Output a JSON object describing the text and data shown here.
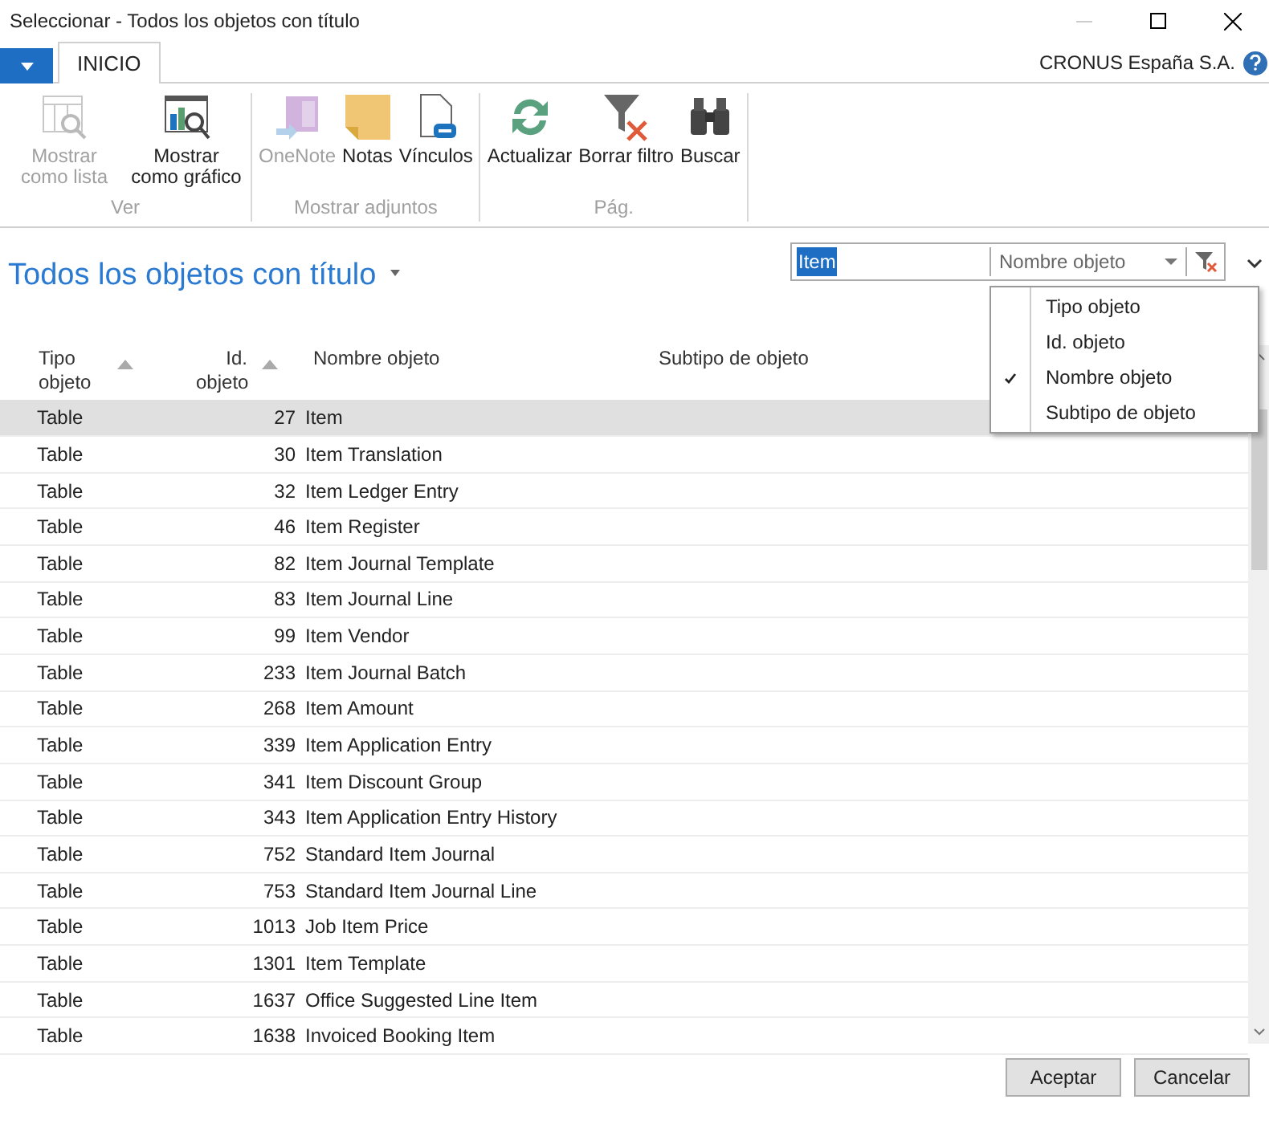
{
  "window": {
    "title": "Seleccionar - Todos los objetos con título"
  },
  "tabs": [
    {
      "label": "INICIO",
      "selected": true
    }
  ],
  "company": "CRONUS España S.A.",
  "ribbon_groups": [
    {
      "label": "Ver",
      "buttons": [
        {
          "label": "Mostrar como lista",
          "disabled": true
        },
        {
          "label": "Mostrar como gráfico",
          "disabled": false
        }
      ]
    },
    {
      "label": "Mostrar adjuntos",
      "buttons": [
        {
          "label": "OneNote",
          "disabled": true
        },
        {
          "label": "Notas",
          "disabled": false
        },
        {
          "label": "Vínculos",
          "disabled": false
        }
      ]
    },
    {
      "label": "Pág.",
      "buttons": [
        {
          "label": "Actualizar",
          "disabled": false
        },
        {
          "label": "Borrar filtro",
          "disabled": false
        },
        {
          "label": "Buscar",
          "disabled": false
        }
      ]
    }
  ],
  "page_title": "Todos los objetos con título",
  "filter": {
    "value": "Item",
    "field": "Nombre objeto"
  },
  "filter_menu": [
    {
      "label": "Tipo objeto",
      "selected": false
    },
    {
      "label": "Id. objeto",
      "selected": false
    },
    {
      "label": "Nombre objeto",
      "selected": true
    },
    {
      "label": "Subtipo de objeto",
      "selected": false
    }
  ],
  "table": {
    "columns": [
      {
        "label": "Tipo objeto",
        "sorted": true
      },
      {
        "label": "Id. objeto",
        "sorted": true
      },
      {
        "label": "Nombre objeto",
        "sorted": false
      },
      {
        "label": "Subtipo de objeto",
        "sorted": false
      }
    ],
    "rows": [
      {
        "type": "Table",
        "id": "27",
        "name": "Item",
        "selected": true
      },
      {
        "type": "Table",
        "id": "30",
        "name": "Item Translation",
        "selected": false
      },
      {
        "type": "Table",
        "id": "32",
        "name": "Item Ledger Entry",
        "selected": false
      },
      {
        "type": "Table",
        "id": "46",
        "name": "Item Register",
        "selected": false
      },
      {
        "type": "Table",
        "id": "82",
        "name": "Item Journal Template",
        "selected": false
      },
      {
        "type": "Table",
        "id": "83",
        "name": "Item Journal Line",
        "selected": false
      },
      {
        "type": "Table",
        "id": "99",
        "name": "Item Vendor",
        "selected": false
      },
      {
        "type": "Table",
        "id": "233",
        "name": "Item Journal Batch",
        "selected": false
      },
      {
        "type": "Table",
        "id": "268",
        "name": "Item Amount",
        "selected": false
      },
      {
        "type": "Table",
        "id": "339",
        "name": "Item Application Entry",
        "selected": false
      },
      {
        "type": "Table",
        "id": "341",
        "name": "Item Discount Group",
        "selected": false
      },
      {
        "type": "Table",
        "id": "343",
        "name": "Item Application Entry History",
        "selected": false
      },
      {
        "type": "Table",
        "id": "752",
        "name": "Standard Item Journal",
        "selected": false
      },
      {
        "type": "Table",
        "id": "753",
        "name": "Standard Item Journal Line",
        "selected": false
      },
      {
        "type": "Table",
        "id": "1013",
        "name": "Job Item Price",
        "selected": false
      },
      {
        "type": "Table",
        "id": "1301",
        "name": "Item Template",
        "selected": false
      },
      {
        "type": "Table",
        "id": "1637",
        "name": "Office Suggested Line Item",
        "selected": false
      },
      {
        "type": "Table",
        "id": "1638",
        "name": "Invoiced Booking Item",
        "selected": false
      }
    ]
  },
  "buttons": [
    "Aceptar",
    "Cancelar"
  ]
}
